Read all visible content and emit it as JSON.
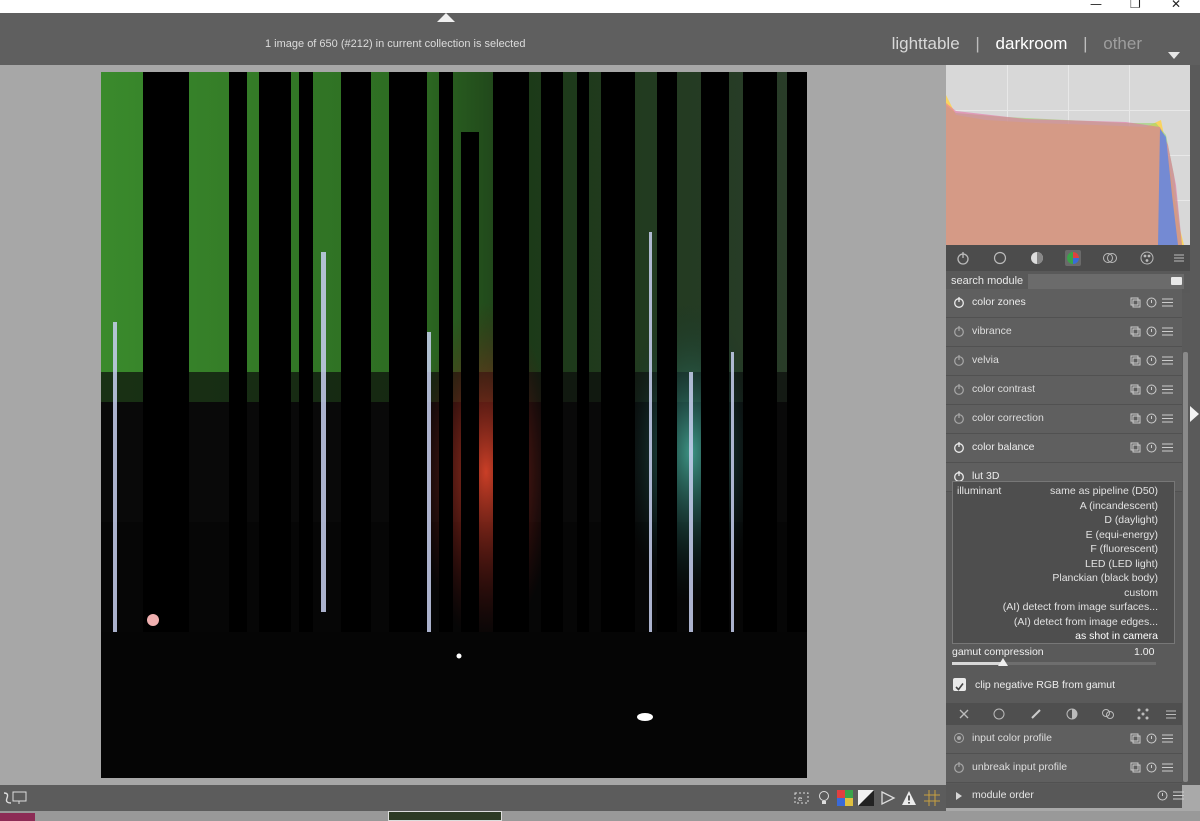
{
  "window": {
    "minimize": "—",
    "restore": "❐",
    "close": "✕"
  },
  "header": {
    "status": "1 image of 650 (#212) in current collection is selected",
    "views": {
      "lighttable": "lighttable",
      "darkroom": "darkroom",
      "other": "other",
      "separator": "|"
    }
  },
  "search": {
    "label": "search module",
    "placeholder": ""
  },
  "modules_top": [
    {
      "label": "color zones",
      "enabled": true
    },
    {
      "label": "vibrance",
      "enabled": false
    },
    {
      "label": "velvia",
      "enabled": false
    },
    {
      "label": "color contrast",
      "enabled": false
    },
    {
      "label": "color correction",
      "enabled": false
    },
    {
      "label": "color balance",
      "enabled": true
    },
    {
      "label": "lut 3D",
      "enabled": true
    }
  ],
  "illuminant": {
    "label": "illuminant",
    "options": [
      "same as pipeline (D50)",
      "A (incandescent)",
      "D (daylight)",
      "E (equi-energy)",
      "F (fluorescent)",
      "LED (LED light)",
      "Planckian (black body)",
      "custom",
      "(AI) detect from image surfaces...",
      "(AI) detect from image edges...",
      "as shot in camera"
    ],
    "selected": "as shot in camera"
  },
  "gamut": {
    "label": "gamut compression",
    "value": "1.00",
    "level": 0.25
  },
  "clip": {
    "label": "clip negative RGB from gamut",
    "checked": true
  },
  "modules_bottom": [
    {
      "label": "input color profile",
      "enabled": false
    },
    {
      "label": "unbreak input profile",
      "enabled": false
    }
  ],
  "module_order": {
    "label": "module order"
  },
  "colors": {
    "accent": "#ffffff",
    "panel": "#5f5f5f",
    "background": "#a9a9a9"
  }
}
